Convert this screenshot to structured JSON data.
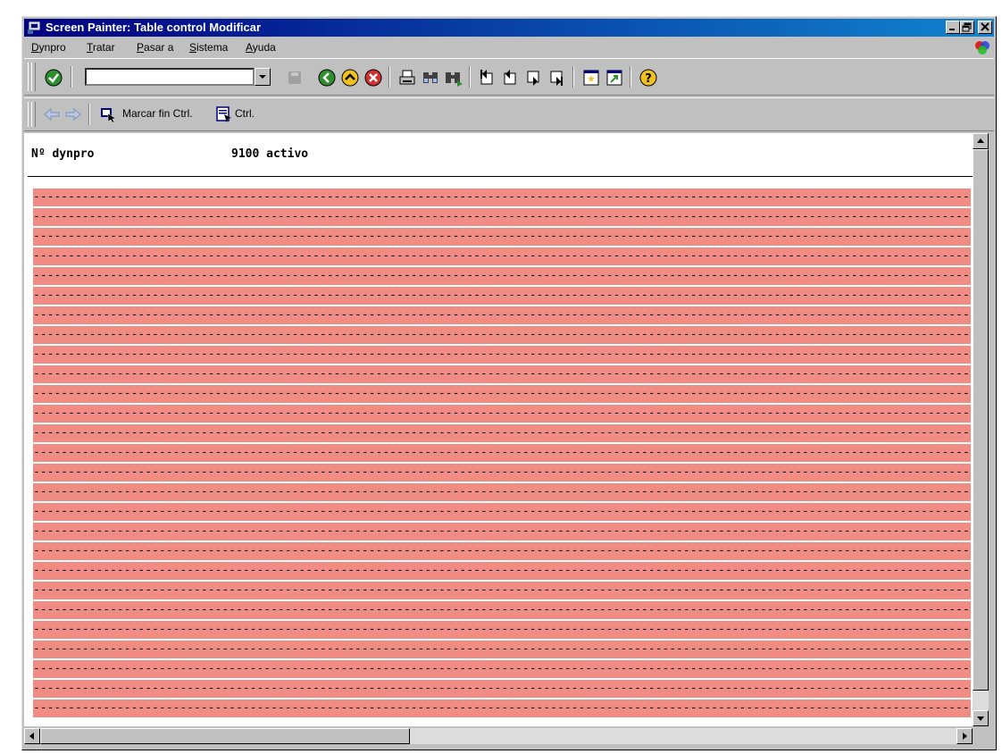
{
  "window": {
    "title": "Screen Painter: Table control  Modificar",
    "controls": [
      "minimize",
      "maximize",
      "close"
    ]
  },
  "menu": {
    "items": [
      {
        "first": "D",
        "rest": "ynpro"
      },
      {
        "first": "T",
        "rest": "ratar"
      },
      {
        "first": "P",
        "rest": "asar a"
      },
      {
        "first": "S",
        "rest": "istema"
      },
      {
        "first": "A",
        "rest": "yuda"
      }
    ]
  },
  "toolbar": {
    "command_field_value": "",
    "buttons": [
      "enter-icon",
      "save-icon",
      "back-icon",
      "exit-icon",
      "cancel-icon",
      "print-icon",
      "find-icon",
      "find-next-icon",
      "first-page-icon",
      "previous-page-icon",
      "next-page-icon",
      "last-page-icon",
      "create-session-icon",
      "shortcut-icon",
      "help-icon"
    ]
  },
  "app_toolbar": {
    "mark_end_label": "Marcar fin Ctrl.",
    "ctrl_label": "Ctrl."
  },
  "screen": {
    "dynpro_label": "Nº dynpro",
    "dynpro_value": "9100 activo"
  },
  "table": {
    "row_count": 27,
    "row_pattern": "-"
  },
  "colors": {
    "title_bar": "#000080",
    "table_row": "#f08c84",
    "workspace": "#ffffff",
    "chrome": "#c0c0c0"
  }
}
